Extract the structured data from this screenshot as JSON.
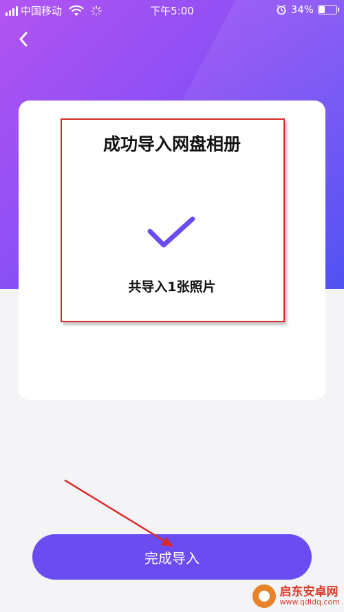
{
  "status_bar": {
    "carrier": "中国移动",
    "time": "下午5:00",
    "battery": "34%"
  },
  "nav": {
    "back_icon": "chevron-left-icon"
  },
  "card": {
    "title": "成功导入网盘相册",
    "check_icon": "checkmark-icon",
    "count_text": "共导入1张照片"
  },
  "actions": {
    "done_label": "完成导入"
  },
  "watermark": {
    "name": "启东安卓网",
    "url": "www.qdldq.com"
  },
  "colors": {
    "accent": "#6b4cf0",
    "highlight": "#d82a2a"
  }
}
